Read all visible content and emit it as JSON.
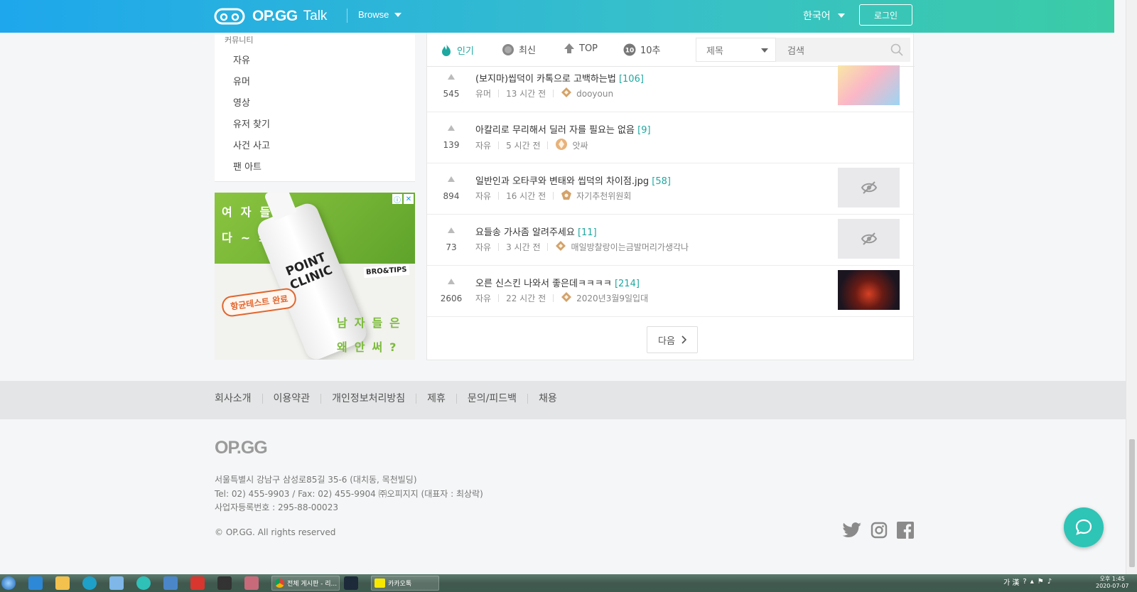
{
  "header": {
    "brand": "OP.GG",
    "product": "Talk",
    "browse_label": "Browse",
    "language": "한국어",
    "login_label": "로그인"
  },
  "sidebar": {
    "category_label": "커뮤니티",
    "items": [
      "자유",
      "유머",
      "영상",
      "유저 찾기",
      "사건 사고",
      "팬 아트"
    ]
  },
  "ad": {
    "line1": "여자들은",
    "line2": "다~쓰는데",
    "product": "POINT CLINIC",
    "stamp": "항균테스트 완료",
    "brand": "BRO&TIPS",
    "line3": "남자들은",
    "line4": "왜안써?"
  },
  "tabs": [
    {
      "label": "인기",
      "icon": "flame-icon",
      "active": true
    },
    {
      "label": "최신",
      "icon": "clock-icon",
      "active": false
    },
    {
      "label": "TOP",
      "icon": "arrow-up-icon",
      "active": false
    },
    {
      "label": "10추",
      "icon": "ten-badge-icon",
      "active": false
    }
  ],
  "filter": {
    "selected": "제목"
  },
  "search": {
    "placeholder": "검색"
  },
  "posts": [
    {
      "votes": "545",
      "title": "(보지마)씹덕이 카톡으로 고백하는법",
      "comments": "[106]",
      "category": "유머",
      "time": "13 시간 전",
      "author": "dooyoun",
      "thumb": "anime"
    },
    {
      "votes": "139",
      "title": "아칼리로 무리해서 딜러 자를 필요는 없음",
      "comments": "[9]",
      "category": "자유",
      "time": "5 시간 전",
      "author": "앗싸",
      "thumb": "none"
    },
    {
      "votes": "894",
      "title": "일반인과 오타쿠와 변태와 씹덕의 차이점.jpg",
      "comments": "[58]",
      "category": "자유",
      "time": "16 시간 전",
      "author": "자기추천위원회",
      "thumb": "hidden"
    },
    {
      "votes": "73",
      "title": "요들송 가사좀 알려주세요",
      "comments": "[11]",
      "category": "자유",
      "time": "3 시간 전",
      "author": "매일방찰랑이는금발머리가생각나",
      "thumb": "hidden"
    },
    {
      "votes": "2606",
      "title": "오른 신스킨 나와서 좋은데ㅋㅋㅋㅋ",
      "comments": "[214]",
      "category": "자유",
      "time": "22 시간 전",
      "author": "2020년3월9일입대",
      "thumb": "dark"
    }
  ],
  "pagination": {
    "next_label": "다음"
  },
  "footer": {
    "links": [
      "회사소개",
      "이용약관",
      "개인정보처리방침",
      "제휴",
      "문의/피드백",
      "채용"
    ],
    "logo": "OP.GG",
    "address": "서울특별시 강남구 삼성로85길 35-6 (대치동, 목천빌딩)",
    "contact": "Tel: 02) 455-9903 / Fax: 02) 455-9904 ㈜오피지지 (대표자 : 최상락)",
    "biz_no": "사업자등록번호 : 295-88-00023",
    "copyright": "© OP.GG. All rights reserved"
  },
  "taskbar": {
    "task1": "전체 게시판 - 리...",
    "task2": "카카오톡",
    "ime": "가 漢",
    "clock_time": "오후 1:45",
    "clock_date": "2020-07-07"
  },
  "colors": {
    "accent": "#1ea8a0",
    "header_start": "#1ea7ec",
    "header_end": "#3bcca6"
  }
}
